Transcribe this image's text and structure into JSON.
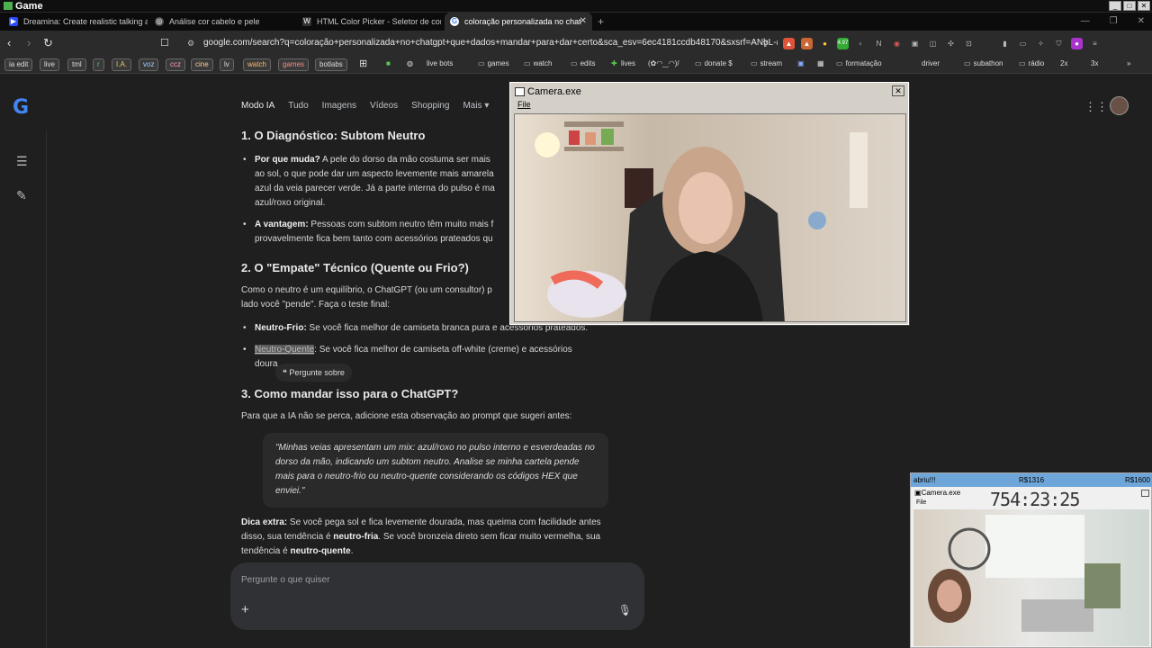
{
  "window": {
    "title": "Game"
  },
  "tabs": [
    {
      "label": "Dreamina: Create realistic talking ava",
      "icon": "play-icon"
    },
    {
      "label": "Análise cor cabelo e pele",
      "icon": "openai-icon"
    },
    {
      "label": "HTML Color Picker - Seletor de cor",
      "icon": "w3-icon"
    },
    {
      "label": "coloração personalizada no chat",
      "icon": "google-icon",
      "active": true
    }
  ],
  "address": {
    "url": "google.com/search?q=coloração+personalizada+no+chatgpt+que+dados+mandar+para+dar+certo&sca_esv=6ec4181ccdb48170&sxsrf=ANbL-n..."
  },
  "extensions": {
    "badge": "4.97"
  },
  "bookmarks": [
    {
      "label": "ia edit",
      "type": "chip"
    },
    {
      "label": "live",
      "type": "chip"
    },
    {
      "label": "tml",
      "type": "chip"
    },
    {
      "label": "r",
      "type": "chip"
    },
    {
      "label": "I.A.",
      "type": "chip"
    },
    {
      "label": "voz",
      "type": "chip"
    },
    {
      "label": "ccz",
      "type": "chip"
    },
    {
      "label": "cine",
      "type": "chip"
    },
    {
      "label": "lv",
      "type": "chip"
    },
    {
      "label": "watch",
      "type": "chip"
    },
    {
      "label": "games",
      "type": "chip"
    },
    {
      "label": "botlabs",
      "type": "chip"
    },
    {
      "label": "live bots",
      "type": "link"
    },
    {
      "label": "games",
      "type": "folder"
    },
    {
      "label": "watch",
      "type": "folder"
    },
    {
      "label": "edits",
      "type": "folder"
    },
    {
      "label": "lives",
      "type": "link"
    },
    {
      "label": "(✿◠‿◠)/",
      "type": "link"
    },
    {
      "label": "donate $",
      "type": "folder"
    },
    {
      "label": "stream",
      "type": "folder"
    },
    {
      "label": "formatação",
      "type": "folder"
    },
    {
      "label": "driver",
      "type": "link"
    },
    {
      "label": "subathon",
      "type": "folder"
    },
    {
      "label": "rádio",
      "type": "folder"
    },
    {
      "label": "2x",
      "type": "link"
    },
    {
      "label": "3x",
      "type": "link"
    }
  ],
  "search_tabs": [
    "Modo IA",
    "Tudo",
    "Imagens",
    "Vídeos",
    "Shopping",
    "Mais"
  ],
  "content": {
    "h1": "1. O Diagnóstico: Subtom Neutro",
    "b1_bold": "Por que muda?",
    "b1_text_1": " A pele do dorso da mão costuma ser mais ",
    "b1_text_2": "ao sol, o que pode dar um aspecto levemente mais amarela",
    "b1_text_3": "azul da veia parecer verde. Já a parte interna do pulso é ma",
    "b1_text_4": "azul/roxo original.",
    "b2_bold": "A vantagem:",
    "b2_text_1": " Pessoas com subtom neutro têm muito mais f",
    "b2_text_2": "provavelmente fica bem tanto com acessórios prateados qu",
    "h2": "2. O \"Empate\" Técnico (Quente ou Frio?)",
    "p2_1": "Como o neutro é um equilíbrio, o ChatGPT (ou um consultor) p",
    "p2_2": "lado você \"pende\". Faça o teste final:",
    "b3_bold": "Neutro-Frio:",
    "b3_text": " Se você fica melhor de camiseta branca pura e acessórios prateados.",
    "b4_hl": "Neutro-Quente",
    "b4_text": ": Se você fica melhor de camiseta off-white (creme) e acessórios",
    "b4_text2": "doura",
    "ask_about": "Pergunte sobre",
    "h3": "3. Como mandar isso para o ChatGPT?",
    "p3": "Para que a IA não se perca, adicione esta observação ao prompt que sugeri antes:",
    "quote": "\"Minhas veias apresentam um mix: azul/roxo no pulso interno e esverdeadas no dorso da mão, indicando um subtom neutro. Analise se minha cartela pende mais para o neutro-frio ou neutro-quente considerando os códigos HEX que enviei.\"",
    "tip_bold": "Dica extra:",
    "tip_1": " Se você pega sol e fica levemente dourada, mas queima com facilidade antes",
    "tip_2a": "disso, sua tendência é ",
    "tip_2b": "neutro-fria",
    "tip_2c": ". Se você bronzeia direto sem ficar muito vermelha, sua",
    "tip_3a": "tendência é ",
    "tip_3b": "neutro-quente",
    "tip_3c": "."
  },
  "composer": {
    "placeholder": "Pergunte o que quiser"
  },
  "camera": {
    "title": "Camera.exe",
    "menu": "File"
  },
  "mini_overlay": {
    "left": "abriu!!!",
    "mid": "R$1316",
    "right": "R$1600",
    "timer": "754:23:25",
    "cam_title": "Camera.exe",
    "file": "File"
  }
}
